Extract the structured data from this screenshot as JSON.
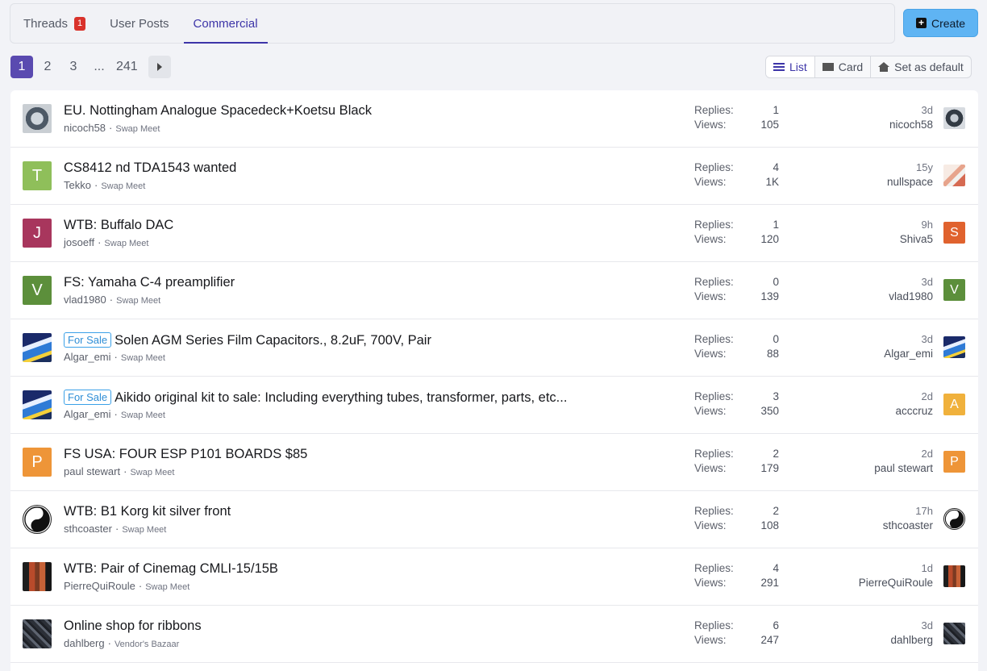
{
  "tabs": [
    {
      "label": "Threads",
      "badge": "1"
    },
    {
      "label": "User Posts"
    },
    {
      "label": "Commercial",
      "active": true
    }
  ],
  "create_label": "Create",
  "pagination": {
    "pages": [
      "1",
      "2",
      "3",
      "...",
      "241"
    ],
    "current": "1"
  },
  "view_modes": {
    "list": "List",
    "card": "Card",
    "set_default": "Set as default"
  },
  "labels": {
    "replies": "Replies:",
    "views": "Views:"
  },
  "threads": [
    {
      "title": "EU. Nottingham Analogue Spacedeck+Koetsu Black",
      "prefix": "",
      "author": "nicoch58",
      "forum": "Swap Meet",
      "replies": "1",
      "views": "105",
      "last_time": "3d",
      "last_user": "nicoch58",
      "author_avatar": {
        "letter": "",
        "color": "",
        "pic": "disc"
      },
      "last_avatar": {
        "letter": "",
        "color": "",
        "pic": "disc-s"
      }
    },
    {
      "title": "CS8412 nd TDA1543 wanted",
      "prefix": "",
      "author": "Tekko",
      "forum": "Swap Meet",
      "replies": "4",
      "views": "1K",
      "last_time": "15y",
      "last_user": "nullspace",
      "author_avatar": {
        "letter": "T",
        "color": "#8fbf5a",
        "pic": ""
      },
      "last_avatar": {
        "letter": "",
        "color": "",
        "pic": "pixel"
      }
    },
    {
      "title": "WTB: Buffalo DAC",
      "prefix": "",
      "author": "josoeff",
      "forum": "Swap Meet",
      "replies": "1",
      "views": "120",
      "last_time": "9h",
      "last_user": "Shiva5",
      "author_avatar": {
        "letter": "J",
        "color": "#a8365d",
        "pic": ""
      },
      "last_avatar": {
        "letter": "S",
        "color": "#e0622e",
        "pic": ""
      }
    },
    {
      "title": "FS: Yamaha C-4 preamplifier",
      "prefix": "",
      "author": "vlad1980",
      "forum": "Swap Meet",
      "replies": "0",
      "views": "139",
      "last_time": "3d",
      "last_user": "vlad1980",
      "author_avatar": {
        "letter": "V",
        "color": "#5c8f3b",
        "pic": ""
      },
      "last_avatar": {
        "letter": "V",
        "color": "#5c8f3b",
        "pic": ""
      }
    },
    {
      "title": "Solen AGM Series Film Capacitors., 8.2uF, 700V, Pair",
      "prefix": "For Sale",
      "author": "Algar_emi",
      "forum": "Swap Meet",
      "replies": "0",
      "views": "88",
      "last_time": "3d",
      "last_user": "Algar_emi",
      "author_avatar": {
        "letter": "",
        "color": "",
        "pic": "dog"
      },
      "last_avatar": {
        "letter": "",
        "color": "",
        "pic": "dog"
      }
    },
    {
      "title": "Aikido original kit to sale: Including everything tubes, transformer, parts, etc...",
      "prefix": "For Sale",
      "author": "Algar_emi",
      "forum": "Swap Meet",
      "replies": "3",
      "views": "350",
      "last_time": "2d",
      "last_user": "acccruz",
      "author_avatar": {
        "letter": "",
        "color": "",
        "pic": "dog"
      },
      "last_avatar": {
        "letter": "A",
        "color": "#f0b13c",
        "pic": ""
      }
    },
    {
      "title": "FS USA: FOUR ESP P101 BOARDS $85",
      "prefix": "",
      "author": "paul stewart",
      "forum": "Swap Meet",
      "replies": "2",
      "views": "179",
      "last_time": "2d",
      "last_user": "paul stewart",
      "author_avatar": {
        "letter": "P",
        "color": "#ee9538",
        "pic": ""
      },
      "last_avatar": {
        "letter": "P",
        "color": "#ee9538",
        "pic": ""
      }
    },
    {
      "title": "WTB: B1 Korg kit silver front",
      "prefix": "",
      "author": "sthcoaster",
      "forum": "Swap Meet",
      "replies": "2",
      "views": "108",
      "last_time": "17h",
      "last_user": "sthcoaster",
      "author_avatar": {
        "letter": "",
        "color": "",
        "pic": "yin"
      },
      "last_avatar": {
        "letter": "",
        "color": "",
        "pic": "yin"
      }
    },
    {
      "title": "WTB: Pair of Cinemag CMLI-15/15B",
      "prefix": "",
      "author": "PierreQuiRoule",
      "forum": "Swap Meet",
      "replies": "4",
      "views": "291",
      "last_time": "1d",
      "last_user": "PierreQuiRoule",
      "author_avatar": {
        "letter": "",
        "color": "",
        "pic": "speaker"
      },
      "last_avatar": {
        "letter": "",
        "color": "",
        "pic": "speaker"
      }
    },
    {
      "title": "Online shop for ribbons",
      "prefix": "",
      "author": "dahlberg",
      "forum": "Vendor's Bazaar",
      "replies": "6",
      "views": "247",
      "last_time": "3d",
      "last_user": "dahlberg",
      "author_avatar": {
        "letter": "",
        "color": "",
        "pic": "dark"
      },
      "last_avatar": {
        "letter": "",
        "color": "",
        "pic": "dark"
      }
    }
  ],
  "colors": {
    "accent": "#3d35a8",
    "page_current": "#5a4ab0",
    "create": "#5fb4f3",
    "badge": "#d9322b",
    "prefix": "#3ba1e8"
  },
  "icons": {
    "create": "plus-square-icon",
    "list": "list-icon",
    "card": "card-icon",
    "set_default": "home-icon",
    "next": "chevron-right-icon"
  }
}
